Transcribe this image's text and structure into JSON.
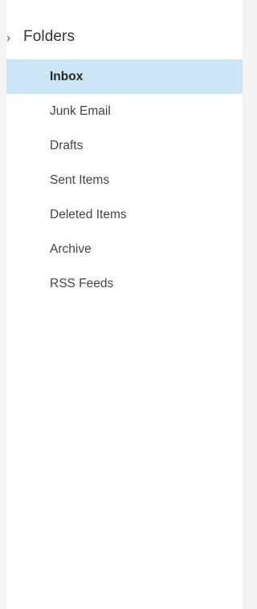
{
  "nav": {
    "section_title": "Folders",
    "toggle_icon": "collapse-chevron-icon",
    "selected_color": "#cde6f7",
    "folders": [
      {
        "label": "Inbox",
        "selected": true
      },
      {
        "label": "Junk Email",
        "selected": false
      },
      {
        "label": "Drafts",
        "selected": false
      },
      {
        "label": "Sent Items",
        "selected": false
      },
      {
        "label": "Deleted Items",
        "selected": false
      },
      {
        "label": "Archive",
        "selected": false
      },
      {
        "label": "RSS Feeds",
        "selected": false
      }
    ]
  }
}
